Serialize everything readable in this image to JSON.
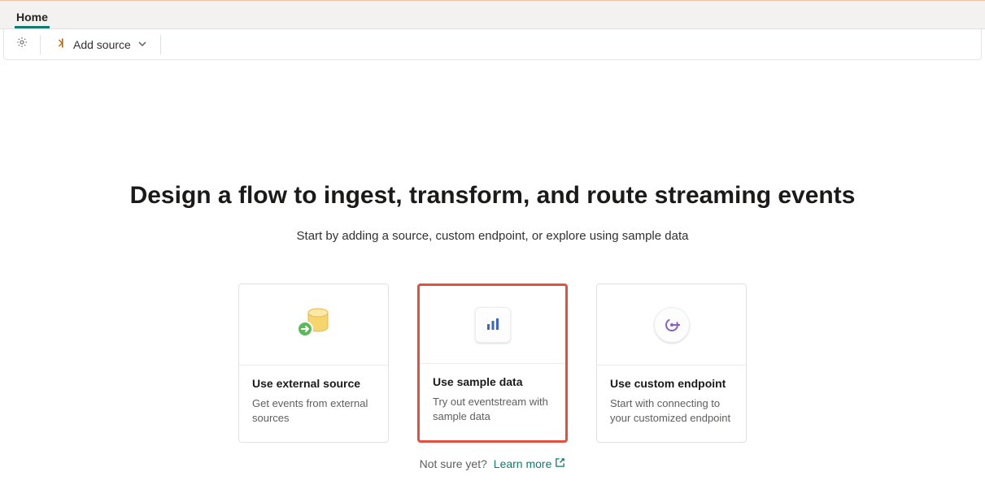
{
  "tabs": {
    "home": "Home"
  },
  "toolbar": {
    "add_source": "Add source"
  },
  "hero": {
    "title": "Design a flow to ingest, transform, and route streaming events",
    "subtitle": "Start by adding a source, custom endpoint, or explore using sample data"
  },
  "cards": [
    {
      "title": "Use external source",
      "desc": "Get events from external sources",
      "icon": "database-arrow"
    },
    {
      "title": "Use sample data",
      "desc": "Try out eventstream with sample data",
      "icon": "bar-chart"
    },
    {
      "title": "Use custom endpoint",
      "desc": "Start with connecting to your customized endpoint",
      "icon": "endpoint"
    }
  ],
  "hint": {
    "text": "Not sure yet?",
    "link": "Learn more"
  }
}
